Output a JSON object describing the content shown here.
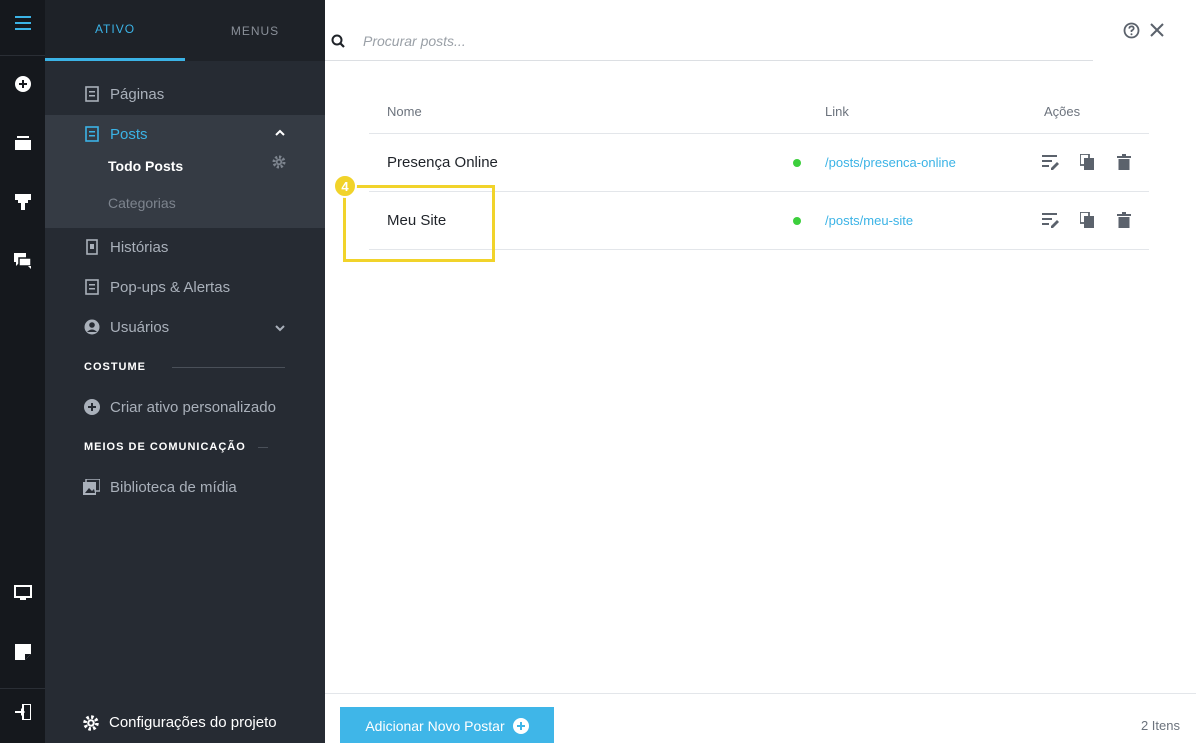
{
  "sidebar": {
    "tabs": {
      "active": "ATIVO",
      "inactive": "MENUS"
    },
    "nav": {
      "paginas": "Páginas",
      "posts": "Posts",
      "todo_posts": "Todo Posts",
      "categorias": "Categorias",
      "historias": "Histórias",
      "popups": "Pop-ups & Alertas",
      "usuarios": "Usuários"
    },
    "sections": {
      "costume": "COSTUME",
      "meios": "MEIOS DE COMUNICAÇÃO"
    },
    "custom_item": "Criar ativo personalizado",
    "media_item": "Biblioteca de mídia",
    "footer": "Configurações do projeto"
  },
  "search": {
    "placeholder": "Procurar posts..."
  },
  "table": {
    "headers": {
      "name": "Nome",
      "link": "Link",
      "actions": "Ações"
    },
    "rows": [
      {
        "name": "Presença Online",
        "link": "/posts/presenca-online",
        "status_color": "#3ccf3c"
      },
      {
        "name": "Meu Site",
        "link": "/posts/meu-site",
        "status_color": "#3ccf3c"
      }
    ]
  },
  "step": {
    "number": "4"
  },
  "footer": {
    "add_button": "Adicionar Novo Postar",
    "count": "2 Itens"
  },
  "colors": {
    "accent": "#3bb3e6",
    "highlight": "#f1d32a",
    "status": "#3ccf3c"
  }
}
